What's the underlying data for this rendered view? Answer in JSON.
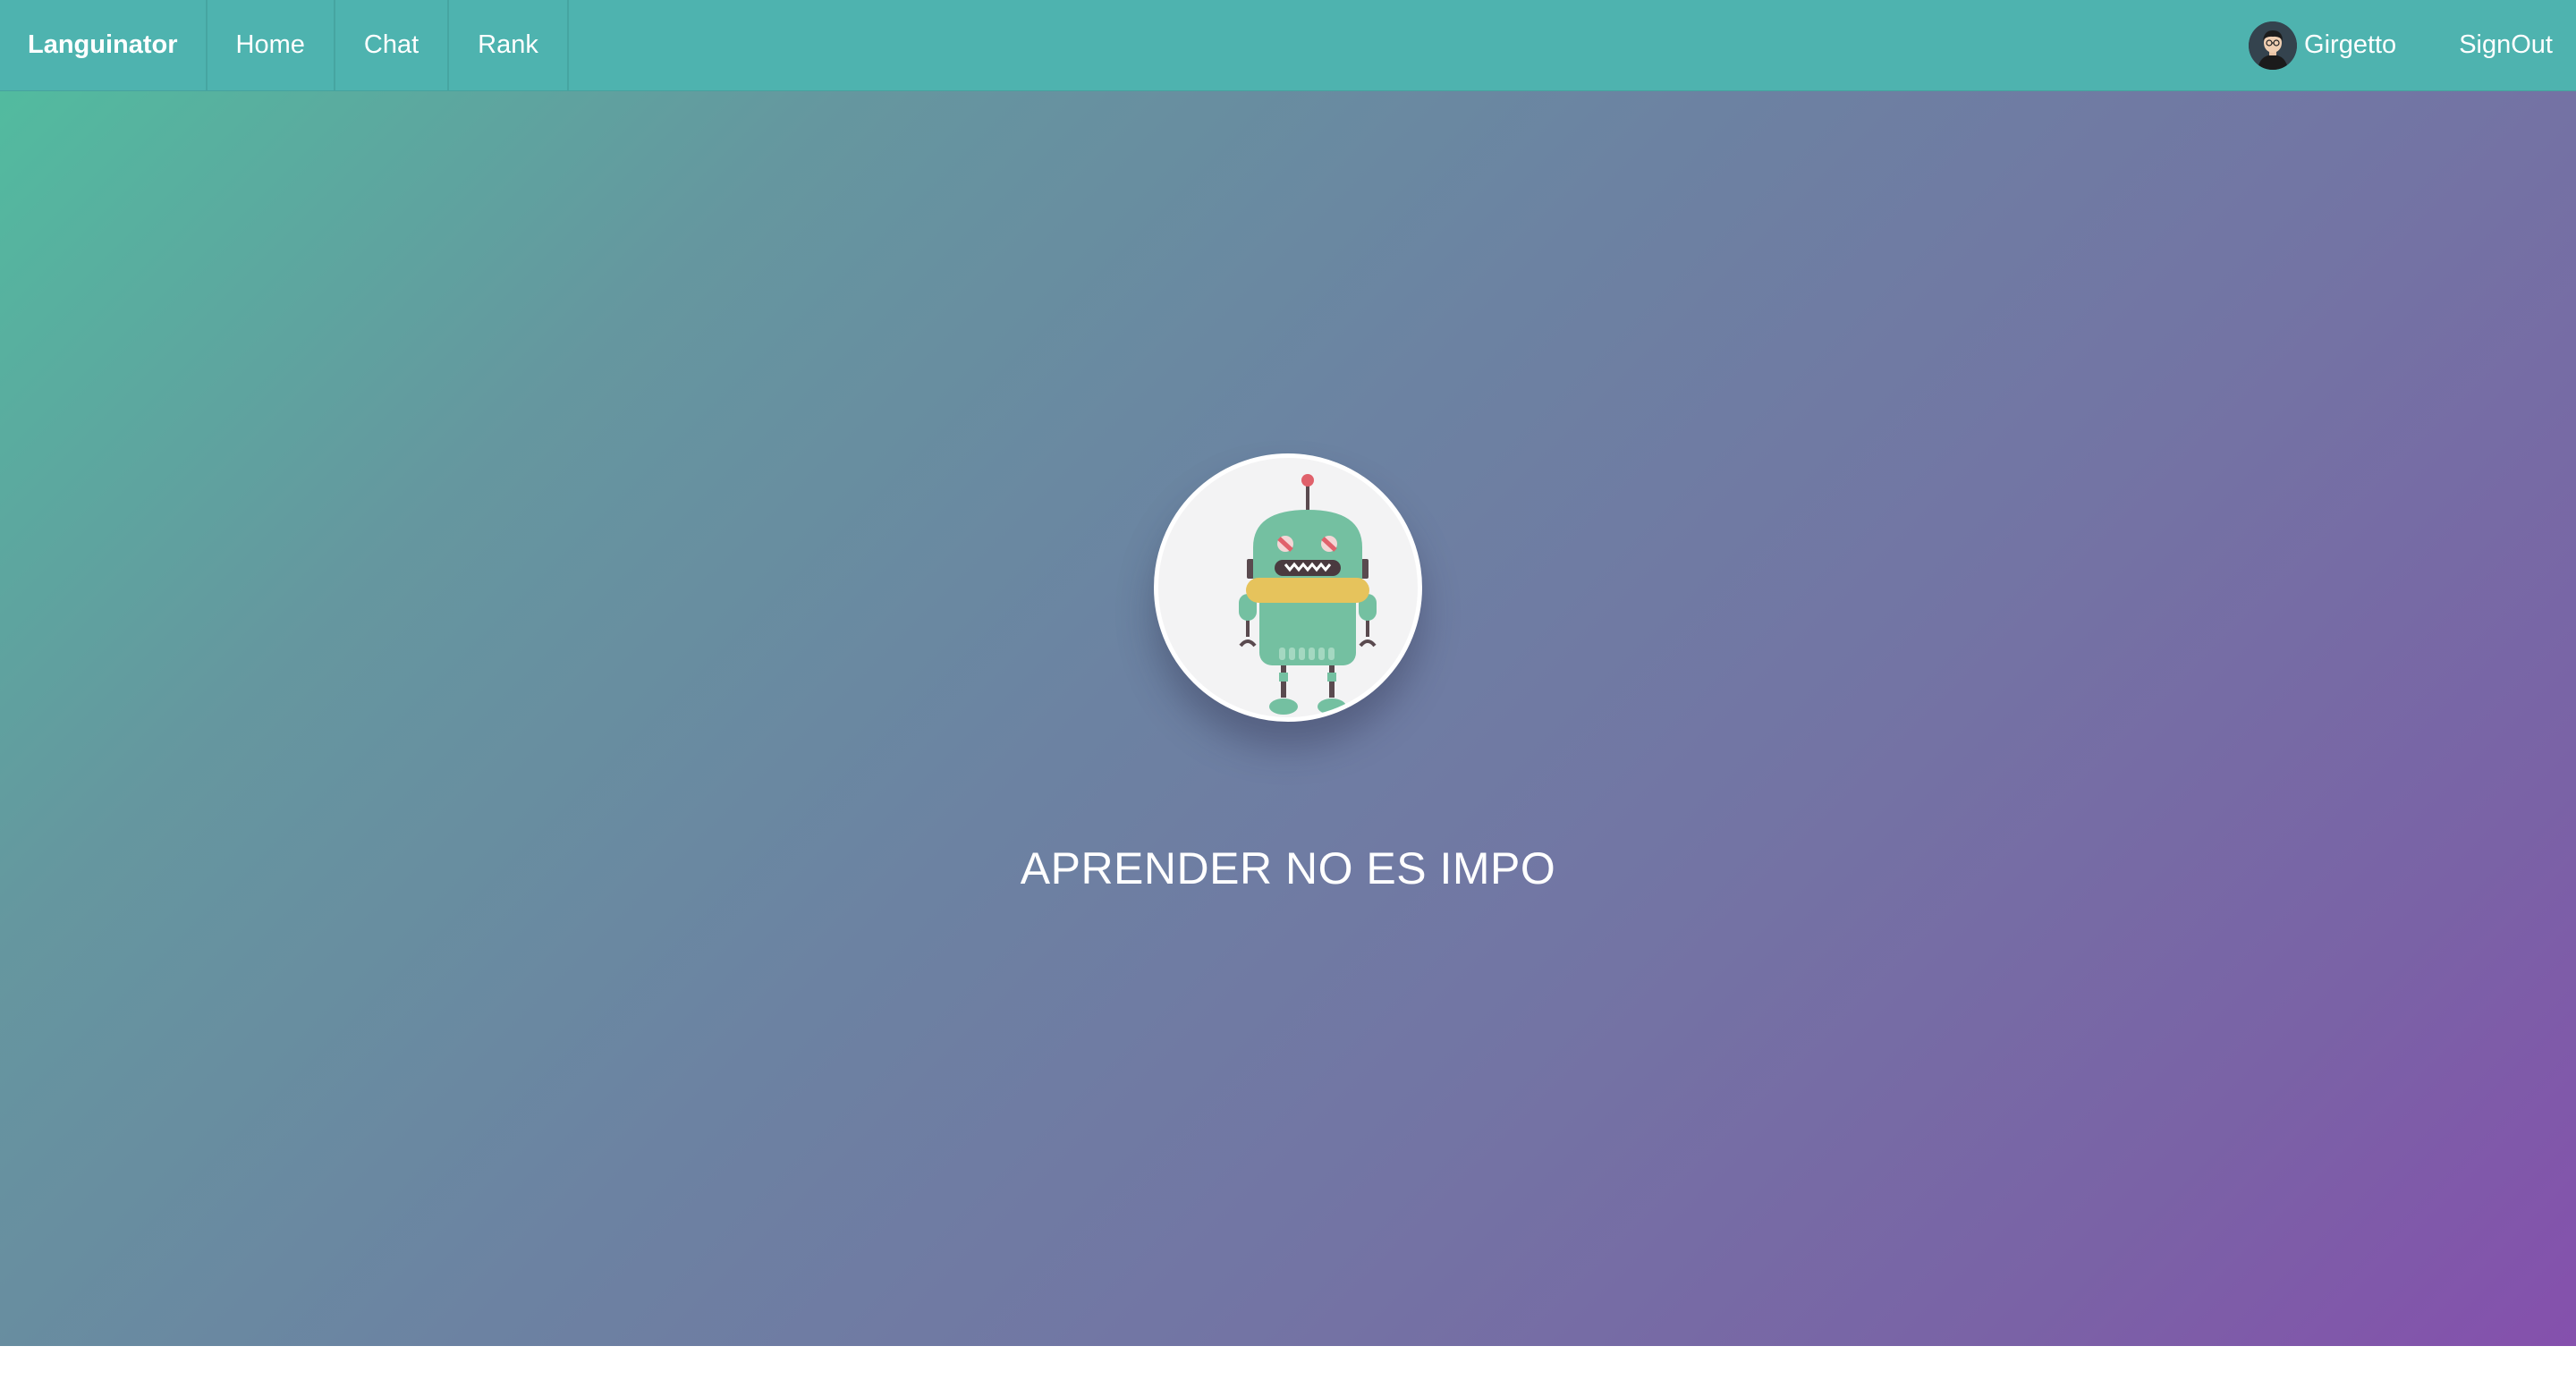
{
  "navbar": {
    "brand": "Languinator",
    "links": [
      {
        "label": "Home"
      },
      {
        "label": "Chat"
      },
      {
        "label": "Rank"
      }
    ],
    "user_name": "Girgetto",
    "signout_label": "SignOut",
    "color": "#4eb3af"
  },
  "hero": {
    "headline": "APRENDER NO ES IMPO",
    "image": "robot-mascot",
    "gradient_colors": [
      "#52bb9f",
      "#6c82a2",
      "#8550ad"
    ]
  }
}
